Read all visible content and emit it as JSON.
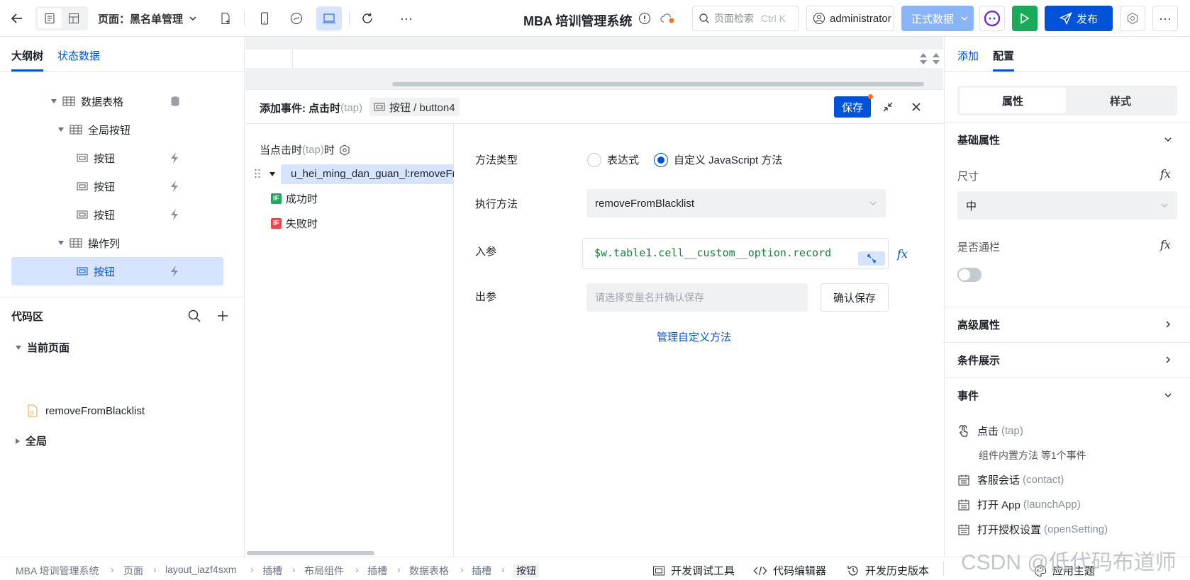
{
  "topbar": {
    "page_label": "页面：黑名单管理",
    "app_title": "MBA 培训管理系统",
    "search_placeholder": "页面检索",
    "search_shortcut": "Ctrl K",
    "user_name": "administrator",
    "env_label": "正式数据",
    "publish_label": "发布"
  },
  "left": {
    "tabs": [
      "大纲树",
      "状态数据"
    ],
    "tree": [
      {
        "label": "数据表格"
      },
      {
        "label": "全局按钮"
      },
      {
        "label": "按钮"
      },
      {
        "label": "按钮"
      },
      {
        "label": "按钮"
      },
      {
        "label": "操作列"
      },
      {
        "label": "按钮"
      }
    ],
    "code_area": {
      "title": "代码区",
      "current_page": "当前页面",
      "file": "removeFromBlacklist",
      "global": "全局"
    }
  },
  "event_panel": {
    "title_prefix": "添加事件: 点击时",
    "title_tap": "(tap)",
    "target": "按钮 / button4",
    "save_label": "保存",
    "trigger_prefix": "当点击时",
    "trigger_tap": "(tap)",
    "trigger_suffix": "时",
    "action_name": "u_hei_ming_dan_guan_l:removeFro",
    "success_tag": "IF",
    "success_label": "成功时",
    "fail_tag": "IF",
    "fail_label": "失败时",
    "method_type_label": "方法类型",
    "radio_expression": "表达式",
    "radio_custom": "自定义 JavaScript 方法",
    "exec_method_label": "执行方法",
    "exec_method_value": "removeFromBlacklist",
    "input_param_label": "入参",
    "input_param_value": "$w.table1.cell__custom__option.record",
    "output_param_label": "出参",
    "output_placeholder": "请选择变量名并确认保存",
    "confirm_save_label": "确认保存",
    "manage_link": "管理自定义方法"
  },
  "right": {
    "tabs": [
      "添加",
      "配置"
    ],
    "segment": [
      "属性",
      "样式"
    ],
    "basic_props": "基础属性",
    "size_label": "尺寸",
    "size_value": "中",
    "full_width_label": "是否通栏",
    "advanced_props": "高级属性",
    "conditional_display": "条件展示",
    "events_label": "事件",
    "events": [
      {
        "name": "点击",
        "en": "(tap)"
      },
      {
        "name": "客服会话",
        "en": "(contact)"
      },
      {
        "name": "打开 App",
        "en": "(launchApp)"
      },
      {
        "name": "打开授权设置",
        "en": "(openSetting)"
      }
    ],
    "tap_sub": "组件内置方法 等1个事件",
    "fx": "fx"
  },
  "bottom": {
    "breadcrumbs": [
      "MBA 培训管理系统",
      "页面",
      "layout_iazf4sxm",
      "插槽",
      "布局组件",
      "插槽",
      "数据表格",
      "插槽",
      "按钮"
    ],
    "dev_tools": "开发调试工具",
    "code_editor": "代码编辑器",
    "history": "开发历史版本",
    "theme": "应用主题",
    "watermark": "CSDN @低代码布道师"
  },
  "colors": {
    "primary": "#0052d9",
    "success": "#1aab5a",
    "env": "#8ab4f8"
  }
}
